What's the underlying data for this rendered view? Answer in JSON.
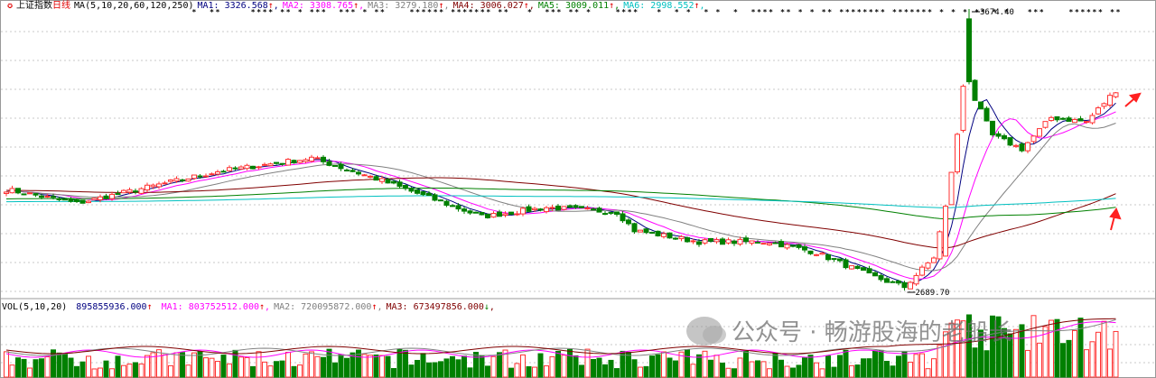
{
  "header": {
    "icon": "red-star-icon",
    "title": "上证指数",
    "period": "日线",
    "ma_params": "MA(5,10,20,60,120,250)",
    "ma": [
      {
        "label": "MA1:",
        "value": "3326.568",
        "arrow": "↑",
        "color": "#000080"
      },
      {
        "label": "MA2:",
        "value": "3308.765",
        "arrow": "↑",
        "color": "#ff00ff"
      },
      {
        "label": "MA3:",
        "value": "3279.180",
        "arrow": "↑",
        "color": "#808080"
      },
      {
        "label": "MA4:",
        "value": "3006.027",
        "arrow": "↑",
        "color": "#800000"
      },
      {
        "label": "MA5:",
        "value": "3009.011",
        "arrow": "↑",
        "color": "#008000"
      },
      {
        "label": "MA6:",
        "value": "2998.552",
        "arrow": "↑",
        "color": "#00c0c0"
      }
    ]
  },
  "volume_header": {
    "params": "VOL(5,10,20)",
    "vol": {
      "value": "895855936.000",
      "arrow": "↑",
      "color": "#000080"
    },
    "ma": [
      {
        "label": "MA1:",
        "value": "803752512.000",
        "arrow": "↑",
        "color": "#ff00ff"
      },
      {
        "label": "MA2:",
        "value": "720095872.000",
        "arrow": "↑",
        "color": "#808080"
      },
      {
        "label": "MA3:",
        "value": "673497856.000",
        "arrow": "↓",
        "color": "#800000"
      }
    ]
  },
  "annotations": {
    "high_label": "3674.40",
    "low_label": "2689.70"
  },
  "watermark": "公众号 · 畅游股海的老船长",
  "colors": {
    "up": "#ff3232",
    "down": "#008000",
    "grid": "#c8c8c8"
  },
  "chart_data": {
    "type": "candlestick",
    "title": "上证指数 日线",
    "candles": 190,
    "ylim": [
      2689.7,
      3674.4
    ],
    "close_keypoints": [
      [
        0,
        3043
      ],
      [
        12,
        2995
      ],
      [
        36,
        3106
      ],
      [
        52,
        3153
      ],
      [
        64,
        3074
      ],
      [
        81,
        2948
      ],
      [
        92,
        2980
      ],
      [
        104,
        2964
      ],
      [
        107,
        2900
      ],
      [
        118,
        2860
      ],
      [
        130,
        2860
      ],
      [
        138,
        2822
      ],
      [
        147,
        2743
      ],
      [
        153,
        2702
      ],
      [
        158,
        2806
      ],
      [
        160,
        2980
      ],
      [
        162,
        3232
      ],
      [
        164,
        3579
      ],
      [
        165,
        3358
      ],
      [
        168,
        3232
      ],
      [
        173,
        3185
      ],
      [
        178,
        3295
      ],
      [
        184,
        3280
      ],
      [
        189,
        3390
      ]
    ],
    "high": 3674.4,
    "low": 2689.7
  }
}
